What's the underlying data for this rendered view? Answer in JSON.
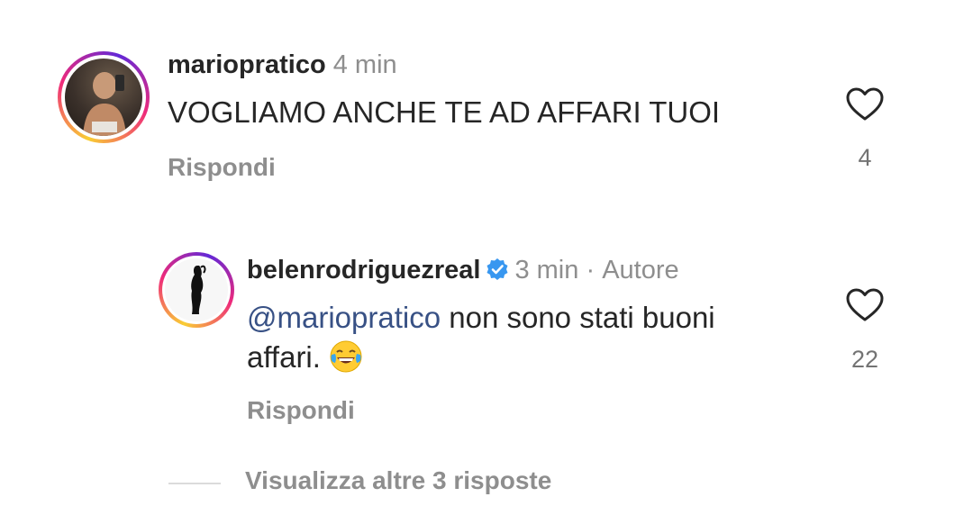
{
  "comment": {
    "username": "mariopratico",
    "time": "4 min",
    "text": "VOGLIAMO ANCHE TE AD AFFARI TUOI",
    "reply_label": "Rispondi",
    "likes": "4",
    "avatar_icon": "user-photo-icon"
  },
  "reply": {
    "username": "belenrodriguezreal",
    "time": "3 min",
    "separator": "·",
    "author_label": "Autore",
    "mention": "@mariopratico",
    "text_line1": " non sono stati buoni",
    "text_line2": "affari.",
    "emoji": "face-with-tears-of-joy-icon",
    "reply_label": "Rispondi",
    "likes": "22",
    "verified_icon": "verified-badge-icon"
  },
  "view_more": {
    "label": "Visualizza altre 3 risposte"
  },
  "colors": {
    "text": "#262626",
    "secondary": "#8e8e8e",
    "mention": "#385185",
    "verified": "#3897f0"
  }
}
